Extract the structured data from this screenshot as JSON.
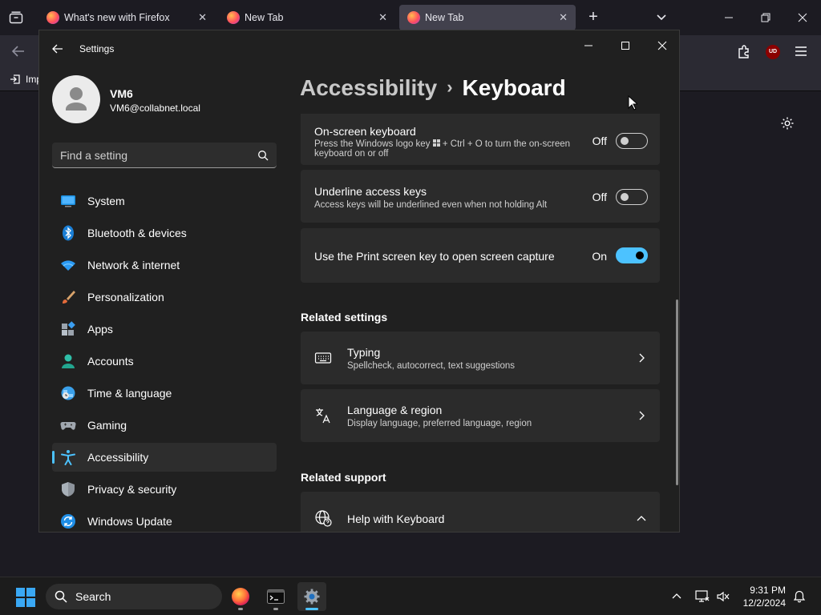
{
  "browser": {
    "tabs": [
      {
        "title": "What's new with Firefox",
        "active": false
      },
      {
        "title": "New Tab",
        "active": false
      },
      {
        "title": "New Tab",
        "active": true
      }
    ],
    "bookmark_item": "Imp",
    "extension_badge": "UD"
  },
  "settings": {
    "app_title": "Settings",
    "profile": {
      "name": "VM6",
      "email": "VM6@collabnet.local"
    },
    "search_placeholder": "Find a setting",
    "nav": [
      {
        "label": "System",
        "icon": "system-icon",
        "selected": false
      },
      {
        "label": "Bluetooth & devices",
        "icon": "bluetooth-icon",
        "selected": false
      },
      {
        "label": "Network & internet",
        "icon": "wifi-icon",
        "selected": false
      },
      {
        "label": "Personalization",
        "icon": "brush-icon",
        "selected": false
      },
      {
        "label": "Apps",
        "icon": "apps-icon",
        "selected": false
      },
      {
        "label": "Accounts",
        "icon": "accounts-icon",
        "selected": false
      },
      {
        "label": "Time & language",
        "icon": "time-language-icon",
        "selected": false
      },
      {
        "label": "Gaming",
        "icon": "gaming-icon",
        "selected": false
      },
      {
        "label": "Accessibility",
        "icon": "accessibility-icon",
        "selected": true
      },
      {
        "label": "Privacy & security",
        "icon": "shield-icon",
        "selected": false
      },
      {
        "label": "Windows Update",
        "icon": "update-icon",
        "selected": false
      }
    ],
    "breadcrumb": {
      "parent": "Accessibility",
      "separator": "›",
      "current": "Keyboard"
    },
    "cards": [
      {
        "title": "On-screen keyboard",
        "desc_before_key": "Press the Windows logo key",
        "desc_after_key": "+ Ctrl + O to turn the on-screen keyboard on or off",
        "state": "Off",
        "on": false
      },
      {
        "title": "Underline access keys",
        "desc": "Access keys will be underlined even when not holding Alt",
        "state": "Off",
        "on": false
      },
      {
        "title": "Use the Print screen key to open screen capture",
        "state": "On",
        "on": true
      }
    ],
    "related_settings": {
      "heading": "Related settings",
      "items": [
        {
          "title": "Typing",
          "desc": "Spellcheck, autocorrect, text suggestions",
          "icon": "keyboard-icon"
        },
        {
          "title": "Language & region",
          "desc": "Display language, preferred language, region",
          "icon": "language-icon"
        }
      ]
    },
    "related_support": {
      "heading": "Related support",
      "items": [
        {
          "title": "Help with Keyboard",
          "icon": "globe-help-icon",
          "expanded": true
        }
      ]
    }
  },
  "taskbar": {
    "search_label": "Search",
    "time": "9:31 PM",
    "date": "12/2/2024"
  },
  "colors": {
    "accent": "#4cc2ff",
    "window_bg": "#202020",
    "card_bg": "#2b2b2b",
    "firefox_bg": "#1c1b22"
  }
}
